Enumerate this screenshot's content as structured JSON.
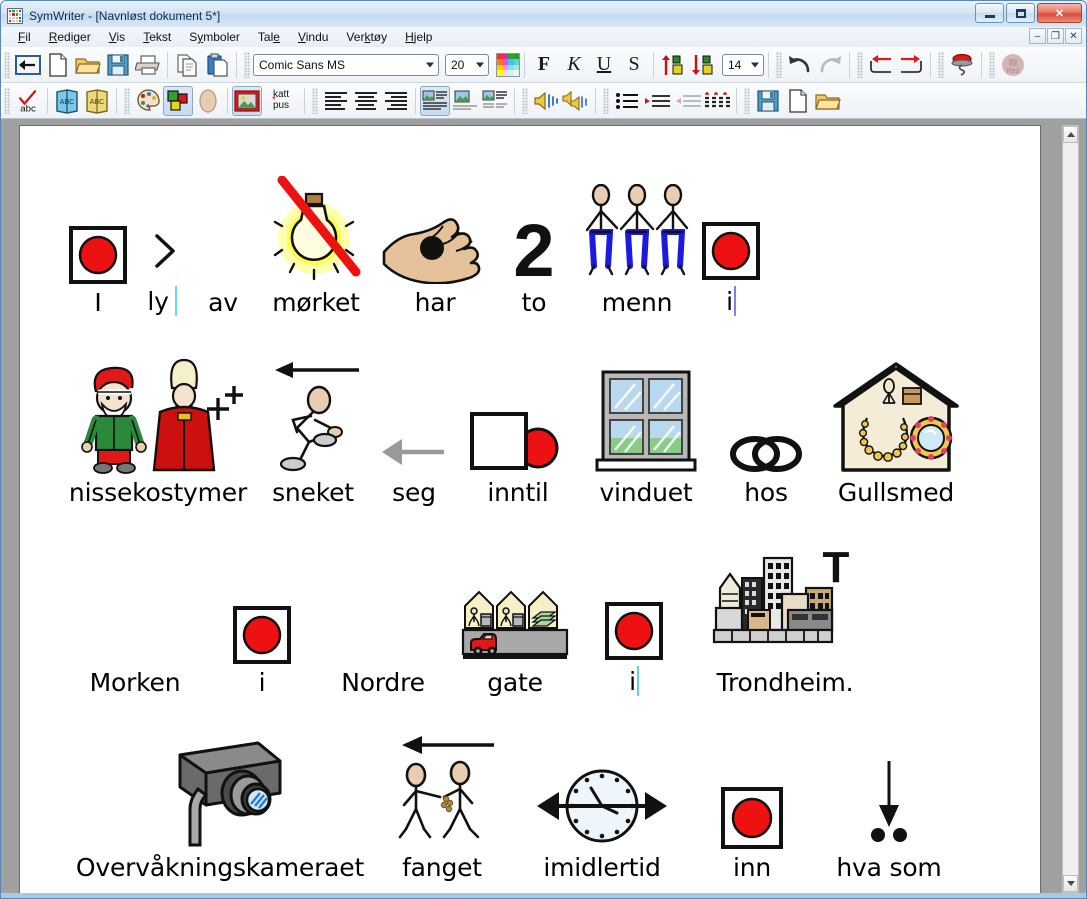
{
  "window": {
    "title": "SymWriter - [Navnløst dokument 5*]",
    "app_icon": "symwriter-grid-icon",
    "buttons": {
      "minimize": "minimize",
      "maximize": "maximize",
      "close": "close"
    },
    "mdi_buttons": {
      "minimize": "–",
      "restore": "❐",
      "close": "✕"
    }
  },
  "menubar": {
    "items": [
      {
        "label": "Fil",
        "accel": "F"
      },
      {
        "label": "Rediger",
        "accel": "R"
      },
      {
        "label": "Vis",
        "accel": "V"
      },
      {
        "label": "Tekst",
        "accel": "T"
      },
      {
        "label": "Symboler",
        "accel": "y"
      },
      {
        "label": "Tale",
        "accel": "e"
      },
      {
        "label": "Vindu",
        "accel": "V"
      },
      {
        "label": "Verktøy",
        "accel": "k"
      },
      {
        "label": "Hjelp",
        "accel": "H"
      }
    ]
  },
  "toolbar_top": {
    "font_name": "Comic Sans MS",
    "font_size": "20",
    "leading_size": "14",
    "buttons": [
      {
        "name": "back-to-start",
        "label": "Tilbake"
      },
      {
        "name": "new-document",
        "label": "Ny"
      },
      {
        "name": "open-document",
        "label": "Åpne"
      },
      {
        "name": "save-document",
        "label": "Lagre"
      },
      {
        "name": "print-document",
        "label": "Skriv ut"
      },
      {
        "name": "copy",
        "label": "Kopier"
      },
      {
        "name": "paste",
        "label": "Lim inn"
      },
      {
        "name": "text-color-palette",
        "label": "Farge"
      },
      {
        "name": "bold",
        "label": "F"
      },
      {
        "name": "italic",
        "label": "K"
      },
      {
        "name": "underline",
        "label": "U"
      },
      {
        "name": "strikethrough",
        "label": "S"
      },
      {
        "name": "increase-size",
        "label": "Større"
      },
      {
        "name": "decrease-size",
        "label": "Mindre"
      },
      {
        "name": "undo",
        "label": "Angre"
      },
      {
        "name": "redo",
        "label": "Gjør om"
      },
      {
        "name": "indent-left",
        "label": "Venstre"
      },
      {
        "name": "indent-right",
        "label": "Høyre"
      },
      {
        "name": "stamp",
        "label": "Stempel"
      },
      {
        "name": "red-button",
        "label": "Red"
      }
    ]
  },
  "toolbar_bottom": {
    "buttons": [
      {
        "name": "spellcheck-abc",
        "label": "abc"
      },
      {
        "name": "symbol-book-blue",
        "label": "ABC"
      },
      {
        "name": "symbol-book-yellow",
        "label": "ABC"
      },
      {
        "name": "palette",
        "label": "Palett"
      },
      {
        "name": "symbol-colour",
        "label": "Symbolfarge"
      },
      {
        "name": "skin-tone",
        "label": "Hudtone"
      },
      {
        "name": "picture-frame",
        "label": "Bilde"
      },
      {
        "name": "qualifier-katt-pus",
        "label_line1": "katt",
        "label_line2": "pus"
      },
      {
        "name": "align-left",
        "label": "Venstrejuster"
      },
      {
        "name": "align-center",
        "label": "Midtstill"
      },
      {
        "name": "align-right",
        "label": "Høyrejuster"
      },
      {
        "name": "symbol-above-text",
        "label": "Symbol over"
      },
      {
        "name": "symbol-only",
        "label": "Kun symbol"
      },
      {
        "name": "symbol-beside-text",
        "label": "Symbol ved siden"
      },
      {
        "name": "speak-word",
        "label": "Les opp"
      },
      {
        "name": "speak-sentence",
        "label": "Les setning"
      },
      {
        "name": "bullet-list",
        "label": "Punktliste"
      },
      {
        "name": "increase-indent",
        "label": "Øk innrykk"
      },
      {
        "name": "decrease-indent",
        "label": "Reduser innrykk"
      },
      {
        "name": "grid-view",
        "label": "Rutenett"
      },
      {
        "name": "save-env",
        "label": "Lagre"
      },
      {
        "name": "new-env",
        "label": "Ny"
      },
      {
        "name": "open-env",
        "label": "Åpne"
      }
    ]
  },
  "document": {
    "rows": [
      {
        "cells": [
          {
            "word": "I",
            "symbol": "red-dot-in-square",
            "caret": false
          },
          {
            "word": "ly",
            "symbol": "greater-than",
            "trailing_separator": true
          },
          {
            "word": "av",
            "symbol": "none"
          },
          {
            "word": "mørket",
            "symbol": "lightbulb-crossed-out"
          },
          {
            "word": "har",
            "symbol": "hand-holding-black-dot"
          },
          {
            "word": "to",
            "symbol": "numeral-two"
          },
          {
            "word": "menn",
            "symbol": "three-people"
          },
          {
            "word": "i",
            "symbol": "red-dot-in-square",
            "caret": true
          }
        ]
      },
      {
        "cells": [
          {
            "word": "nissekostymer",
            "symbol": "santa-and-bishop-costumes"
          },
          {
            "word": "sneket",
            "symbol": "person-sneaking-arrow-left"
          },
          {
            "word": "seg",
            "symbol": "grey-arrow-left"
          },
          {
            "word": "inntil",
            "symbol": "square-with-red-dot-beside"
          },
          {
            "word": "vinduet",
            "symbol": "window-four-panes"
          },
          {
            "word": "hos",
            "symbol": "two-interlocking-rings"
          },
          {
            "word": "Gullsmed",
            "symbol": "jewellery-shop-house"
          }
        ]
      },
      {
        "cells": [
          {
            "word": "Morken",
            "symbol": "none"
          },
          {
            "word": "i",
            "symbol": "red-dot-in-square"
          },
          {
            "word": "Nordre",
            "symbol": "none"
          },
          {
            "word": "gate",
            "symbol": "street-with-houses-and-car"
          },
          {
            "word": "i",
            "symbol": "red-dot-in-square",
            "caret": true
          },
          {
            "word": "Trondheim.",
            "symbol": "city-skyline-with-T"
          }
        ]
      },
      {
        "cells": [
          {
            "word": "Overvåkningskameraet",
            "symbol": "security-camera"
          },
          {
            "word": "fanget",
            "symbol": "two-people-arrow-left"
          },
          {
            "word": "imidlertid",
            "symbol": "clock-double-arrow"
          },
          {
            "word": "inn",
            "symbol": "red-dot-in-square"
          },
          {
            "word": "hva som",
            "symbol": "arrow-down-two-dots"
          }
        ]
      }
    ]
  },
  "colors": {
    "titlebar_start": "#e8f1fa",
    "titlebar_end": "#d8e8f7",
    "close_button": "#d94a38",
    "page_background": "#ffffff",
    "client_background": "#a0a0a0",
    "caret": "#66ccee",
    "symbol_red": "#ee1111",
    "window_border": "#5b87b5"
  },
  "scrollbar": {
    "up_arrow": "▲",
    "down_arrow": "▼"
  }
}
